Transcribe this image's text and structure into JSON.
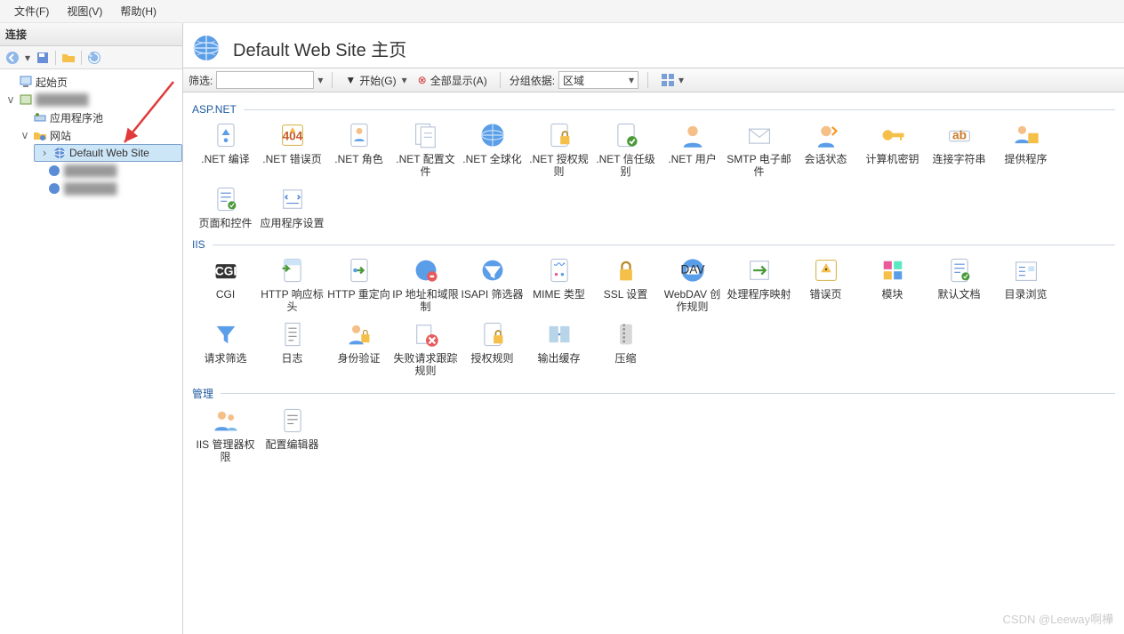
{
  "menu": {
    "file": "文件(F)",
    "view": "视图(V)",
    "help": "帮助(H)"
  },
  "sidebar": {
    "title": "连接",
    "tree": {
      "start": "起始页",
      "server": "███████",
      "apppool": "应用程序池",
      "sites": "网站",
      "site1": "Default Web Site",
      "site2": "███████",
      "site3": "███████"
    }
  },
  "header": {
    "title": "Default Web Site 主页"
  },
  "toolbar": {
    "filter_label": "筛选:",
    "go": "开始(G)",
    "showall": "全部显示(A)",
    "groupby": "分组依据:",
    "group_value": "区域"
  },
  "sections": {
    "aspnet": {
      "title": "ASP.NET",
      "items": [
        ".NET 编译",
        ".NET 错误页",
        ".NET 角色",
        ".NET 配置文件",
        ".NET 全球化",
        ".NET 授权规则",
        ".NET 信任级别",
        ".NET 用户",
        "SMTP 电子邮件",
        "会话状态",
        "计算机密钥",
        "连接字符串",
        "提供程序",
        "页面和控件",
        "应用程序设置"
      ]
    },
    "iis": {
      "title": "IIS",
      "items": [
        "CGI",
        "HTTP 响应标头",
        "HTTP 重定向",
        "IP 地址和域限制",
        "ISAPI 筛选器",
        "MIME 类型",
        "SSL 设置",
        "WebDAV 创作规则",
        "处理程序映射",
        "错误页",
        "模块",
        "默认文档",
        "目录浏览",
        "请求筛选",
        "日志",
        "身份验证",
        "失败请求跟踪规则",
        "授权规则",
        "输出缓存",
        "压缩"
      ]
    },
    "mgmt": {
      "title": "管理",
      "items": [
        "IIS 管理器权限",
        "配置编辑器"
      ]
    }
  },
  "watermark": "CSDN @Leeway啊樺"
}
